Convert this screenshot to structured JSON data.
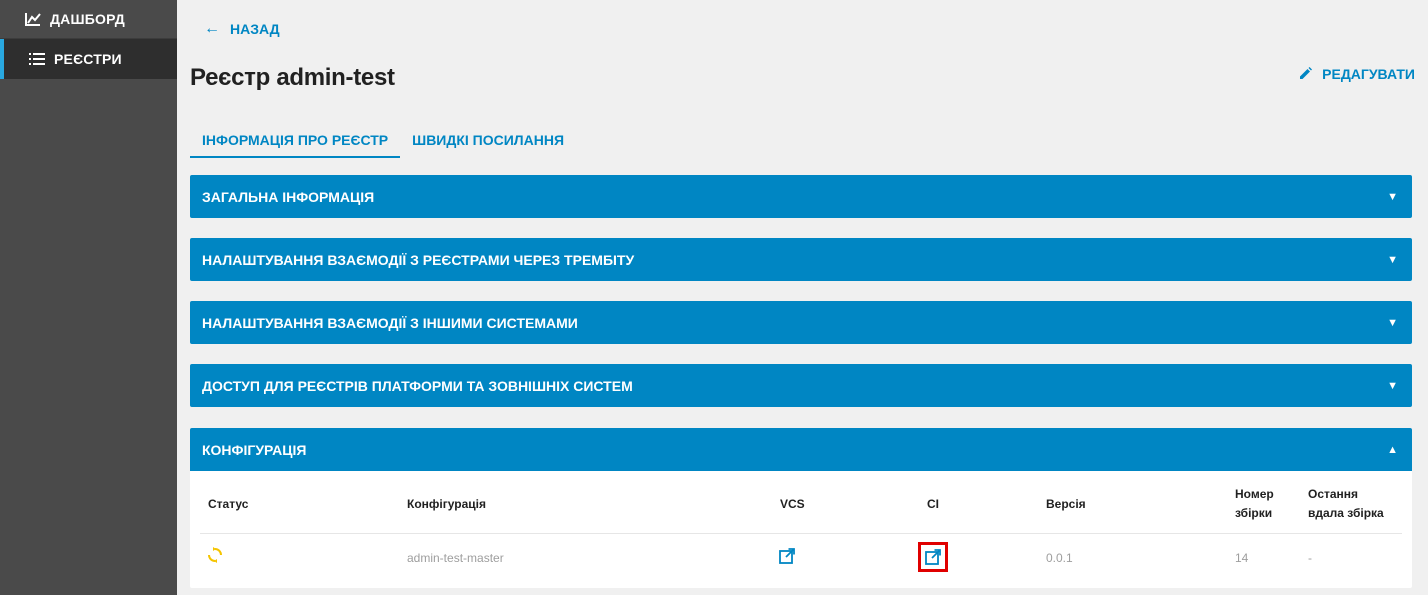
{
  "sidebar": {
    "items": [
      {
        "label": "ДАШБОРД",
        "icon": "chart-icon"
      },
      {
        "label": "РЕЄСТРИ",
        "icon": "list-icon"
      }
    ]
  },
  "header": {
    "back_label": "НАЗАД",
    "title": "Реєстр admin-test",
    "edit_label": "РЕДАГУВАТИ"
  },
  "tabs": [
    {
      "label": "ІНФОРМАЦІЯ ПРО РЕЄСТР",
      "active": true
    },
    {
      "label": "ШВИДКІ ПОСИЛАННЯ",
      "active": false
    }
  ],
  "panels": [
    {
      "label": "ЗАГАЛЬНА ІНФОРМАЦІЯ"
    },
    {
      "label": "НАЛАШТУВАННЯ ВЗАЄМОДІЇ З РЕЄСТРАМИ ЧЕРЕЗ ТРЕМБІТУ"
    },
    {
      "label": "НАЛАШТУВАННЯ ВЗАЄМОДІЇ З ІНШИМИ СИСТЕМАМИ"
    },
    {
      "label": "ДОСТУП ДЛЯ РЕЄСТРІВ ПЛАТФОРМИ ТА ЗОВНІШНІХ СИСТЕМ"
    },
    {
      "label": "КОНФІГУРАЦІЯ"
    }
  ],
  "config_table": {
    "headers": {
      "status": "Статус",
      "config": "Конфігурація",
      "vcs": "VCS",
      "ci": "CI",
      "version": "Версія",
      "build_no_1": "Номер",
      "build_no_2": "збірки",
      "last_ok_1": "Остання",
      "last_ok_2": "вдала збірка"
    },
    "row": {
      "status_icon": "sync-icon",
      "config": "admin-test-master",
      "version": "0.0.1",
      "build_no": "14",
      "last_ok": "-"
    }
  },
  "colors": {
    "accent": "#0086c3",
    "sidebar_bg": "#4a4a4a",
    "status_sync": "#f5c400",
    "highlight": "#e00000"
  }
}
